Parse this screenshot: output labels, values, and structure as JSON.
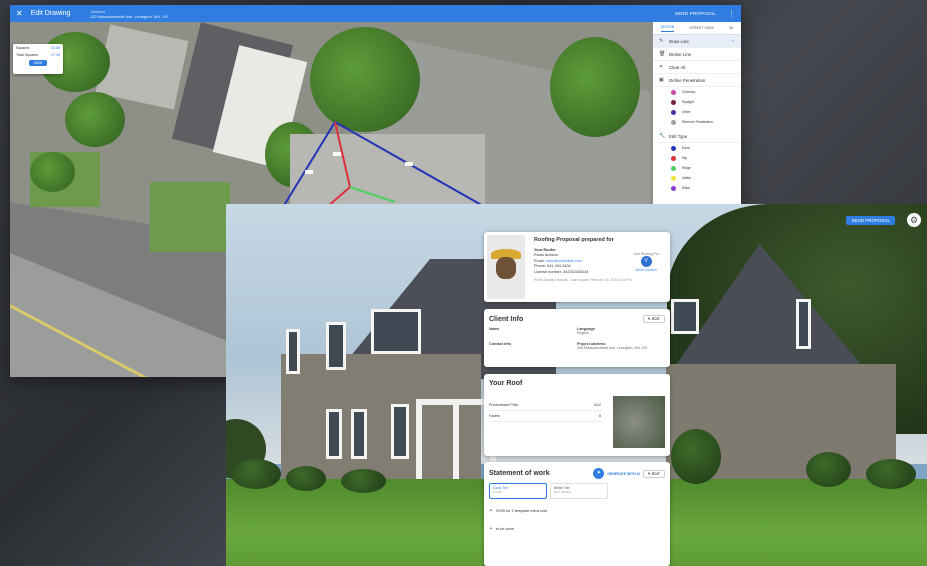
{
  "editor": {
    "title": "Edit Drawing",
    "address_label": "Address",
    "address": "112 Massachusetts Ave, Lexington, MA, US",
    "send_label": "SEND PROPOSAL",
    "info_card": {
      "row1_label": "Squares",
      "row1_value": "23.86",
      "row2_label": "Total Squares",
      "row2_value": "27.45",
      "button": "SAVE"
    },
    "panel": {
      "tabs": [
        "DESIGN",
        "STREET VIEW",
        "3D"
      ],
      "items": [
        "Draw Line",
        "Delete Line",
        "Clear All",
        "Define Penetration"
      ],
      "penetrations": [
        {
          "label": "Chimney",
          "color": "#c84aa8"
        },
        {
          "label": "Skylight",
          "color": "#7a2236"
        },
        {
          "label": "Other",
          "color": "#4b2fa5"
        },
        {
          "label": "Remove Penetration",
          "color": "#9aa0a6"
        }
      ],
      "edit_type": "Edit Type",
      "types": [
        {
          "label": "Eave",
          "color": "#2334b8"
        },
        {
          "label": "Hip",
          "color": "#e0303a"
        },
        {
          "label": "Ridge",
          "color": "#4fcf60"
        },
        {
          "label": "Valley",
          "color": "#f0e23a"
        },
        {
          "label": "Rake",
          "color": "#8c3bd6"
        }
      ]
    }
  },
  "proposal": {
    "send_label": "SEND PROPOSAL",
    "roofer_card": {
      "title": "Roofing Proposal prepared for",
      "your_roofer": "Your Roofer",
      "name": "Roofs Arizona",
      "email_label": "Email:",
      "email": "roofs@rooferlink.com",
      "phone": "Phone: 541-434-3434",
      "license": "License number: 342342345234",
      "meta": "Roofs Quality Network - Last update: February 16, 2023 4:00 PM",
      "rep_label": "Your Roofing Pro",
      "rep_initial": "V",
      "rep_name": "Vince Dowson"
    },
    "client_card": {
      "title": "Client Info",
      "edit": "EDIT",
      "name_label": "Name",
      "language_label": "Language",
      "language": "English",
      "contact_label": "Contact Info",
      "project_label": "Project address",
      "project_address": "346 Massachusetts Ave, Lexington, MA, US"
    },
    "roof_card": {
      "title": "Your Roof",
      "pitch_label": "Predominant Pitch",
      "pitch_value": "4/12",
      "facets_label": "Facets",
      "facets_value": "8"
    },
    "sow_card": {
      "title": "Statement of work",
      "generate": "GENERATE WITH AI",
      "edit": "EDIT",
      "tab1_title": "Good Tier",
      "tab1_sub": "$ 0.00",
      "tab2_title": "Better Tier",
      "tab2_sub": "NOT SAVED",
      "bullets": [
        "SOW for 2 template extra cost",
        "to be done"
      ]
    }
  }
}
